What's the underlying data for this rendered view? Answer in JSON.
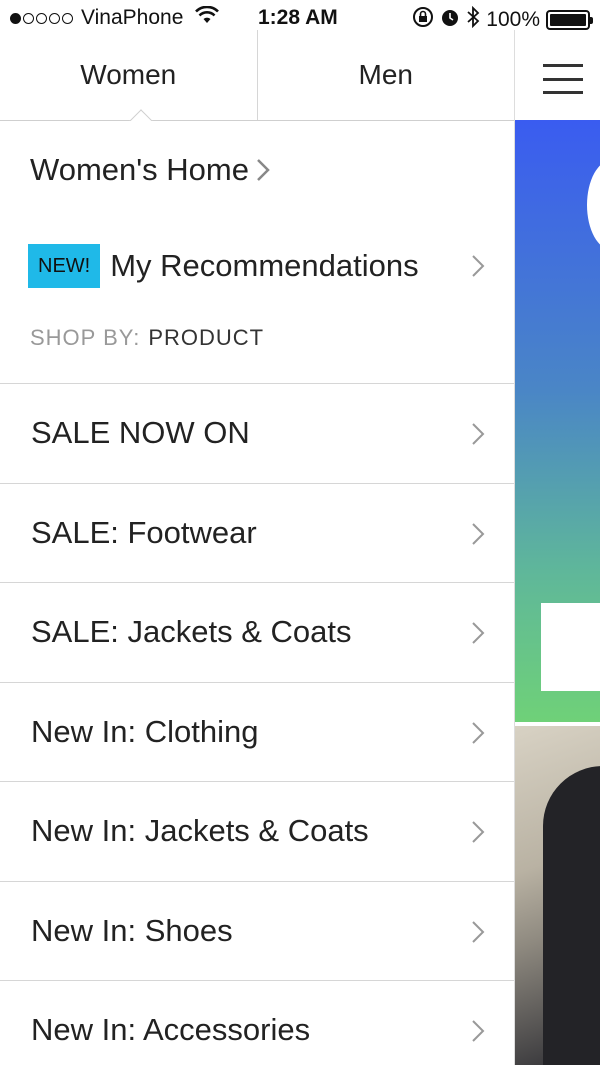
{
  "status_bar": {
    "signal_dots": [
      true,
      false,
      false,
      false,
      false
    ],
    "carrier": "VinaPhone",
    "time": "1:28 AM",
    "battery": "100%"
  },
  "tabs": {
    "women": "Women",
    "men": "Men",
    "active": "women"
  },
  "home_link": "Women's Home",
  "recommendations": {
    "badge": "NEW!",
    "label": "My Recommendations",
    "badge_color": "#1fb9e8"
  },
  "shop_by": {
    "prefix": "SHOP BY:",
    "value": "PRODUCT"
  },
  "menu_items": [
    "SALE NOW ON",
    "SALE: Footwear",
    "SALE: Jackets & Coats",
    "New In: Clothing",
    "New In: Jackets & Coats",
    "New In: Shoes",
    "New In: Accessories"
  ],
  "icons": {
    "wifi": "wifi-icon",
    "lock": "rotation-lock-icon",
    "alarm": "alarm-icon",
    "bluetooth": "bluetooth-icon",
    "battery": "battery-icon",
    "chevron": "chevron-right-icon",
    "menu": "hamburger-menu-icon"
  }
}
